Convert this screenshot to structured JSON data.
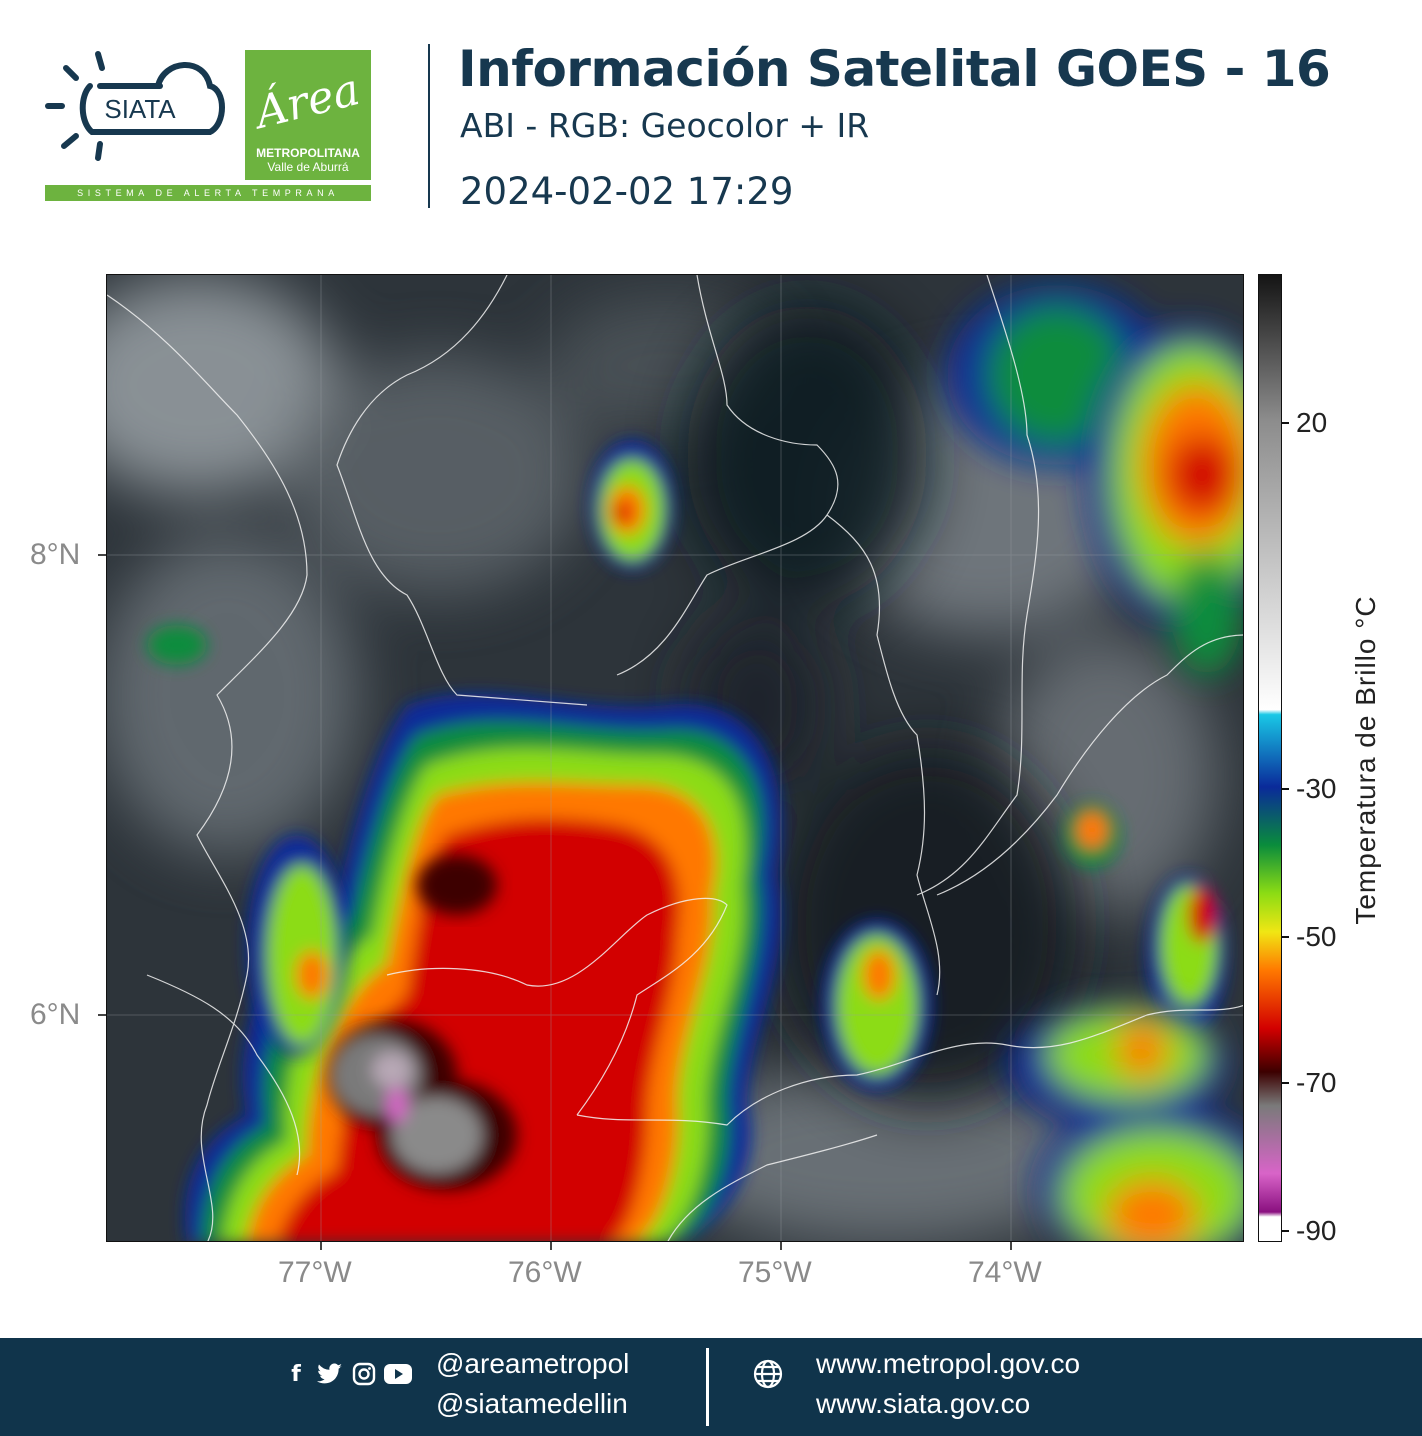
{
  "header": {
    "siata_logo_text": "SIATA",
    "area_logo": {
      "script": "Área",
      "line1": "METROPOLITANA",
      "line2": "Valle de Aburrá"
    },
    "tagline": "SISTEMA DE ALERTA TEMPRANA",
    "title": "Información Satelital GOES - 16",
    "subtitle": "ABI - RGB: Geocolor + IR",
    "timestamp": "2024-02-02 17:29"
  },
  "map": {
    "lat_labels": [
      "8°N",
      "6°N"
    ],
    "lon_labels": [
      "77°W",
      "76°W",
      "75°W",
      "74°W"
    ]
  },
  "colorbar": {
    "title": "Temperatura de Brillo °C",
    "ticks": [
      "20",
      "-30",
      "-50",
      "-70",
      "-90"
    ],
    "colors": [
      "#141414",
      "#8c8c8c",
      "#ffffff",
      "#19c8e6",
      "#0a2a9a",
      "#0a8c3c",
      "#8cdc14",
      "#f0e614",
      "#ff7800",
      "#d20000",
      "#3c0000",
      "#7a7a7a",
      "#d864c8",
      "#8a1080"
    ]
  },
  "footer": {
    "social_icons": [
      "facebook-icon",
      "twitter-icon",
      "instagram-icon",
      "youtube-icon"
    ],
    "handles": [
      "@areametropol",
      "@siatamedellin"
    ],
    "urls": [
      "www.metropol.gov.co",
      "www.siata.gov.co"
    ]
  }
}
